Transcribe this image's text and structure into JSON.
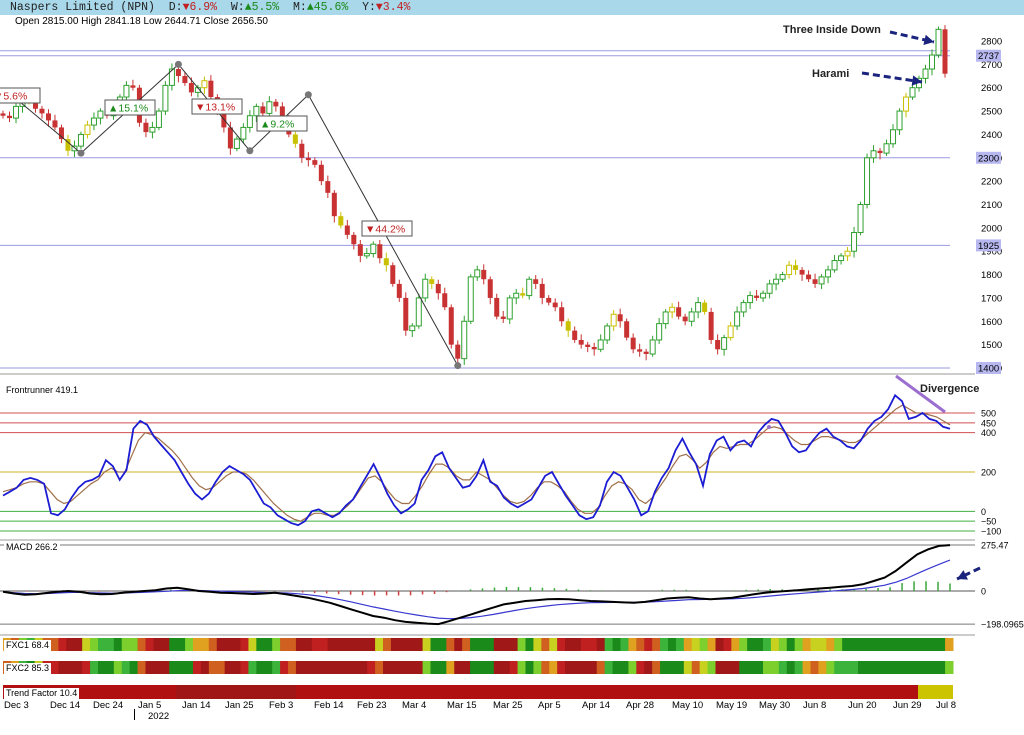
{
  "header": {
    "title": "Naspers Limited (NPN)",
    "periods": [
      {
        "label": "D:",
        "arrow": "▼",
        "pct": "6.9%",
        "dir": "down"
      },
      {
        "label": "W:",
        "arrow": "▲",
        "pct": "5.5%",
        "dir": "up"
      },
      {
        "label": "M:",
        "arrow": "▲",
        "pct": "45.6%",
        "dir": "up"
      },
      {
        "label": "Y:",
        "arrow": "▼",
        "pct": "3.4%",
        "dir": "down"
      }
    ]
  },
  "ohlc_text": "Open 2815.00 High 2841.18 Low 2644.71 Close 2656.50",
  "colors": {
    "up": "#2ea02e",
    "down": "#c83232",
    "header_bg": "#a9d8ea",
    "blue_line": "#1c1cd2",
    "brown_line": "#a0704a",
    "purple": "#9b6fd0",
    "navy": "#1a237e"
  },
  "annotations": {
    "three_inside_down": "Three Inside Down",
    "harami": "Harami",
    "divergence": "Divergence",
    "swings": [
      {
        "text": "5.6%",
        "arrow": "▼",
        "dir": "down"
      },
      {
        "text": "15.1%",
        "arrow": "▲",
        "dir": "up"
      },
      {
        "text": "13.1%",
        "arrow": "▼",
        "dir": "down"
      },
      {
        "text": "9.2%",
        "arrow": "▲",
        "dir": "up"
      },
      {
        "text": "44.2%",
        "arrow": "▼",
        "dir": "down"
      }
    ]
  },
  "price_panel": {
    "ylim": [
      1390,
      2870
    ],
    "ticks": [
      1400,
      1500,
      1600,
      1700,
      1800,
      1900,
      2000,
      2100,
      2200,
      2300,
      2400,
      2500,
      2600,
      2700,
      2800
    ],
    "tick_labels": [
      "1400",
      "1500",
      "1600",
      "1700",
      "1800",
      "1900",
      "2000",
      "2100",
      "2200",
      "2300",
      "2400",
      "2500",
      "2600",
      "2700",
      "2800"
    ],
    "levels": [
      2737,
      2300,
      1925,
      1400
    ],
    "level_labels": [
      "2737",
      "2300",
      "1925",
      "1400"
    ],
    "current_level": 2758
  },
  "frontrunner": {
    "label": "Frontrunner 419.1",
    "ylim": [
      -130,
      620
    ],
    "ticks": [
      500,
      450,
      400,
      200,
      0,
      -50,
      -100
    ],
    "tick_labels": [
      "500",
      "450",
      "400",
      "200",
      "0",
      "−50",
      "−100"
    ],
    "red_levels": [
      500,
      450,
      400
    ],
    "gold_levels": [
      200
    ],
    "green_levels": [
      0,
      -50,
      -100
    ]
  },
  "macd": {
    "label": "MACD 266.2",
    "ylim": [
      -215,
      300
    ],
    "ticks": [
      275.47,
      0,
      -198.0965
    ],
    "tick_labels": [
      "275.47",
      "0",
      "−198.0965"
    ]
  },
  "fxc1_label": "FXC1 68.4",
  "fxc2_label": "FXC2 85.3",
  "trend_label": "Trend Factor 10.4",
  "x_axis": {
    "labels": [
      "Dec 3",
      "Dec 14",
      "Dec 24",
      "Jan 5",
      "Jan 14",
      "Jan 25",
      "Feb 3",
      "Feb 14",
      "Feb 23",
      "Mar 4",
      "Mar 15",
      "Mar 25",
      "Apr 5",
      "Apr 14",
      "Apr 28",
      "May 10",
      "May 19",
      "May 30",
      "Jun 8",
      "Jun 20",
      "Jun 29",
      "Jul 8"
    ],
    "year_label": "2022"
  },
  "chart_data": {
    "type": "candlestick",
    "title": "Naspers Limited (NPN)",
    "x_labels": [
      "Dec 3",
      "Dec 14",
      "Dec 24",
      "Jan 5",
      "Jan 14",
      "Jan 25",
      "Feb 3",
      "Feb 14",
      "Feb 23",
      "Mar 4",
      "Mar 15",
      "Mar 25",
      "Apr 5",
      "Apr 14",
      "Apr 28",
      "May 10",
      "May 19",
      "May 30",
      "Jun 8",
      "Jun 20",
      "Jun 29",
      "Jul 8"
    ],
    "close_series": [
      2480,
      2470,
      2520,
      2540,
      2550,
      2510,
      2490,
      2460,
      2430,
      2380,
      2330,
      2350,
      2400,
      2440,
      2470,
      2500,
      2480,
      2520,
      2560,
      2610,
      2600,
      2450,
      2410,
      2430,
      2500,
      2610,
      2680,
      2650,
      2620,
      2580,
      2600,
      2630,
      2560,
      2500,
      2430,
      2340,
      2380,
      2430,
      2480,
      2520,
      2490,
      2540,
      2520,
      2460,
      2400,
      2360,
      2300,
      2290,
      2270,
      2200,
      2150,
      2050,
      2010,
      1970,
      1930,
      1880,
      1890,
      1930,
      1870,
      1840,
      1760,
      1700,
      1560,
      1580,
      1700,
      1780,
      1760,
      1720,
      1660,
      1500,
      1440,
      1600,
      1790,
      1820,
      1780,
      1700,
      1620,
      1610,
      1700,
      1720,
      1710,
      1780,
      1760,
      1700,
      1680,
      1660,
      1600,
      1560,
      1520,
      1500,
      1490,
      1480,
      1520,
      1580,
      1630,
      1600,
      1530,
      1480,
      1470,
      1460,
      1520,
      1590,
      1640,
      1660,
      1620,
      1600,
      1640,
      1680,
      1640,
      1520,
      1480,
      1530,
      1580,
      1640,
      1680,
      1710,
      1700,
      1720,
      1760,
      1780,
      1800,
      1840,
      1820,
      1800,
      1780,
      1760,
      1790,
      1820,
      1860,
      1880,
      1900,
      1980,
      2100,
      2300,
      2330,
      2320,
      2360,
      2420,
      2500,
      2560,
      2600,
      2640,
      2680,
      2740,
      2850,
      2660
    ],
    "ylim": [
      1390,
      2870
    ],
    "levels": [
      2737,
      2300,
      1925,
      1400
    ],
    "frontrunner_series": [
      {
        "name": "Frontrunner",
        "values": [
          80,
          100,
          120,
          160,
          170,
          160,
          140,
          -10,
          -20,
          10,
          70,
          120,
          150,
          160,
          180,
          260,
          230,
          160,
          210,
          420,
          460,
          440,
          380,
          340,
          300,
          260,
          200,
          140,
          90,
          60,
          90,
          150,
          200,
          230,
          210,
          190,
          160,
          100,
          40,
          20,
          -20,
          -40,
          -60,
          -70,
          -50,
          0,
          10,
          -10,
          -30,
          -10,
          30,
          60,
          120,
          180,
          240,
          170,
          90,
          30,
          -10,
          10,
          40,
          160,
          210,
          280,
          300,
          220,
          170,
          120,
          130,
          180,
          260,
          150,
          130,
          70,
          40,
          20,
          40,
          60,
          120,
          180,
          200,
          140,
          80,
          30,
          -20,
          -40,
          -30,
          30,
          150,
          200,
          180,
          120,
          60,
          -20,
          0,
          100,
          170,
          220,
          310,
          370,
          300,
          240,
          130,
          290,
          360,
          380,
          310,
          350,
          360,
          330,
          400,
          440,
          470,
          460,
          400,
          330,
          300,
          310,
          360,
          400,
          420,
          380,
          360,
          330,
          320,
          360,
          420,
          460,
          480,
          520,
          590,
          560,
          470,
          480,
          500,
          470,
          460,
          430,
          420
        ]
      },
      {
        "name": "Signal",
        "values": [
          100,
          110,
          120,
          140,
          150,
          150,
          140,
          100,
          60,
          40,
          50,
          80,
          110,
          140,
          160,
          200,
          220,
          200,
          200,
          280,
          360,
          400,
          390,
          370,
          340,
          310,
          270,
          220,
          170,
          130,
          110,
          120,
          150,
          180,
          200,
          200,
          190,
          160,
          120,
          80,
          40,
          10,
          -20,
          -40,
          -50,
          -30,
          -10,
          -10,
          -20,
          -20,
          0,
          30,
          70,
          120,
          170,
          180,
          150,
          100,
          60,
          40,
          40,
          80,
          130,
          190,
          240,
          240,
          220,
          180,
          160,
          160,
          200,
          180,
          160,
          120,
          80,
          50,
          40,
          50,
          80,
          120,
          150,
          150,
          130,
          100,
          50,
          10,
          -10,
          -10,
          20,
          80,
          130,
          150,
          140,
          110,
          60,
          40,
          70,
          120,
          170,
          230,
          280,
          290,
          260,
          220,
          250,
          300,
          330,
          320,
          330,
          340,
          340,
          360,
          390,
          420,
          430,
          420,
          390,
          360,
          340,
          340,
          360,
          380,
          380,
          370,
          360,
          350,
          350,
          370,
          400,
          430,
          460,
          490,
          520,
          540,
          520,
          500,
          500,
          490,
          480,
          460,
          440
        ]
      }
    ],
    "macd_series": [
      {
        "name": "MACD",
        "values": [
          -5,
          -15,
          -22,
          -20,
          -12,
          -5,
          0,
          -5,
          -15,
          -20,
          -18,
          -10,
          -5,
          0,
          5,
          15,
          20,
          10,
          0,
          -5,
          -10,
          -12,
          -15,
          -18,
          -15,
          -10,
          -20,
          -30,
          -40,
          -55,
          -70,
          -90,
          -110,
          -130,
          -150,
          -160,
          -175,
          -185,
          -190,
          -195,
          -198,
          -180,
          -160,
          -140,
          -120,
          -100,
          -80,
          -70,
          -60,
          -55,
          -50,
          -48,
          -50,
          -55,
          -60,
          -62,
          -65,
          -68,
          -70,
          -65,
          -55,
          -45,
          -40,
          -38,
          -45,
          -50,
          -45,
          -40,
          -30,
          -20,
          -10,
          -5,
          0,
          5,
          10,
          15,
          20,
          25,
          30,
          40,
          60,
          80,
          120,
          170,
          220,
          250,
          270,
          275
        ]
      },
      {
        "name": "Signal",
        "values": [
          -5,
          -10,
          -15,
          -16,
          -15,
          -12,
          -9,
          -8,
          -10,
          -12,
          -13,
          -12,
          -10,
          -8,
          -5,
          -2,
          2,
          4,
          3,
          1,
          -1,
          -3,
          -5,
          -7,
          -9,
          -10,
          -12,
          -16,
          -22,
          -30,
          -40,
          -52,
          -65,
          -80,
          -95,
          -108,
          -121,
          -133,
          -144,
          -154,
          -162,
          -166,
          -164,
          -159,
          -151,
          -141,
          -129,
          -117,
          -106,
          -97,
          -89,
          -82,
          -77,
          -73,
          -70,
          -69,
          -68,
          -68,
          -68,
          -67,
          -64,
          -60,
          -56,
          -52,
          -51,
          -50,
          -49,
          -47,
          -44,
          -39,
          -33,
          -27,
          -21,
          -16,
          -11,
          -6,
          -1,
          4,
          9,
          15,
          24,
          35,
          52,
          75,
          104,
          133,
          160,
          185
        ]
      }
    ],
    "fxc1_label": "FXC1 68.4",
    "fxc2_label": "FXC2 85.3",
    "trend_label": "Trend Factor 10.4"
  }
}
